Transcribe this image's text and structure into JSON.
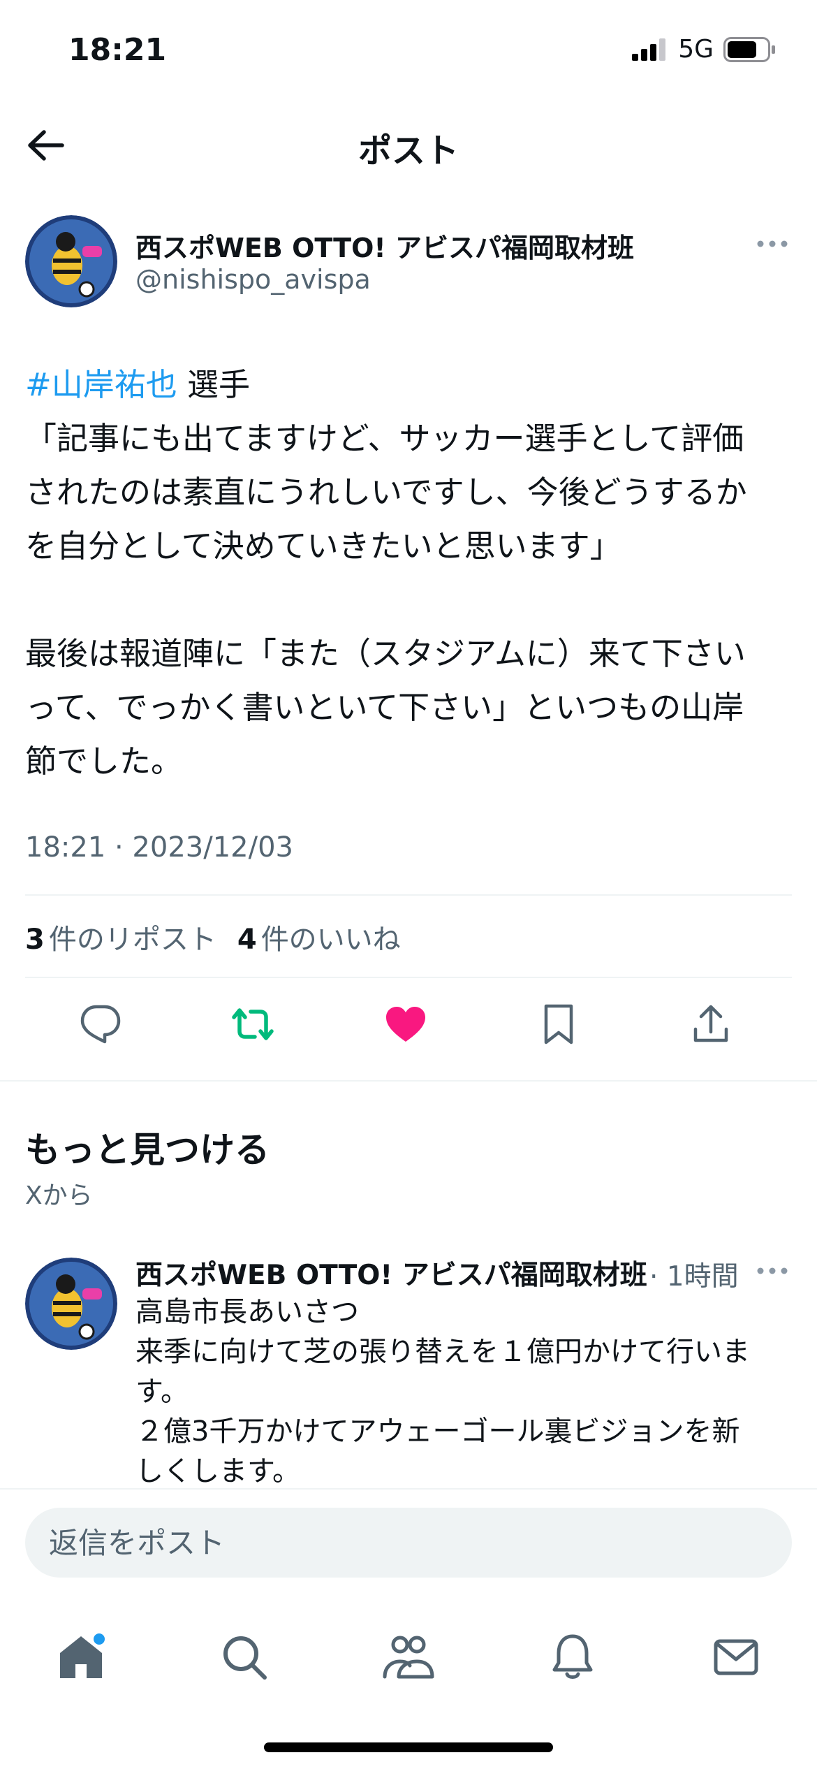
{
  "status_bar": {
    "time": "18:21",
    "network": "5G",
    "signal_bars": 3,
    "battery_level_percent": 75
  },
  "nav": {
    "title": "ポスト",
    "back_icon": "arrow-left-icon"
  },
  "post": {
    "author_name": "西スポWEB OTTO! アビスパ福岡取材班",
    "author_handle": "@nishispo_avispa",
    "hashtag": "#山岸祐也",
    "hashtag_suffix": " 選手",
    "quote_lines": [
      "「記事にも出てますけど、サッカー選手として評価",
      "されたのは素直にうれしいですし、今後どうするか",
      "を自分として決めていきたいと思います」"
    ],
    "closing_lines": [
      "最後は報道陣に「また（スタジアムに）来て下さい",
      "って、でっかく書いといて下さい」といつもの山岸",
      "節でした。"
    ],
    "timestamp": "18:21 · 2023/12/03",
    "reposts_count": "3",
    "reposts_label": "件のリポスト",
    "likes_count": "4",
    "likes_label": "件のいいね",
    "liked": true,
    "colors": {
      "link": "#1d9bf0",
      "repost": "#00ba7c",
      "like": "#f91880",
      "muted": "#536471"
    }
  },
  "actions": [
    "reply-icon",
    "repost-icon",
    "like-icon",
    "bookmark-icon",
    "share-icon"
  ],
  "discover": {
    "title": "もっと見つける",
    "subtitle": "Xから",
    "item": {
      "author_name": "西スポWEB OTTO! アビスパ福岡取材班",
      "time": "· 1時間",
      "lines": [
        "高島市長あいさつ",
        "来季に向けて芝の張り替えを１億円かけて行いま",
        "す。",
        "２億3千万かけてアウェーゴール裏ビジョンを新",
        "しくします。"
      ]
    }
  },
  "reply": {
    "placeholder": "返信をポスト"
  },
  "tabs": [
    "home-icon",
    "search-icon",
    "communities-icon",
    "notifications-icon",
    "messages-icon"
  ]
}
